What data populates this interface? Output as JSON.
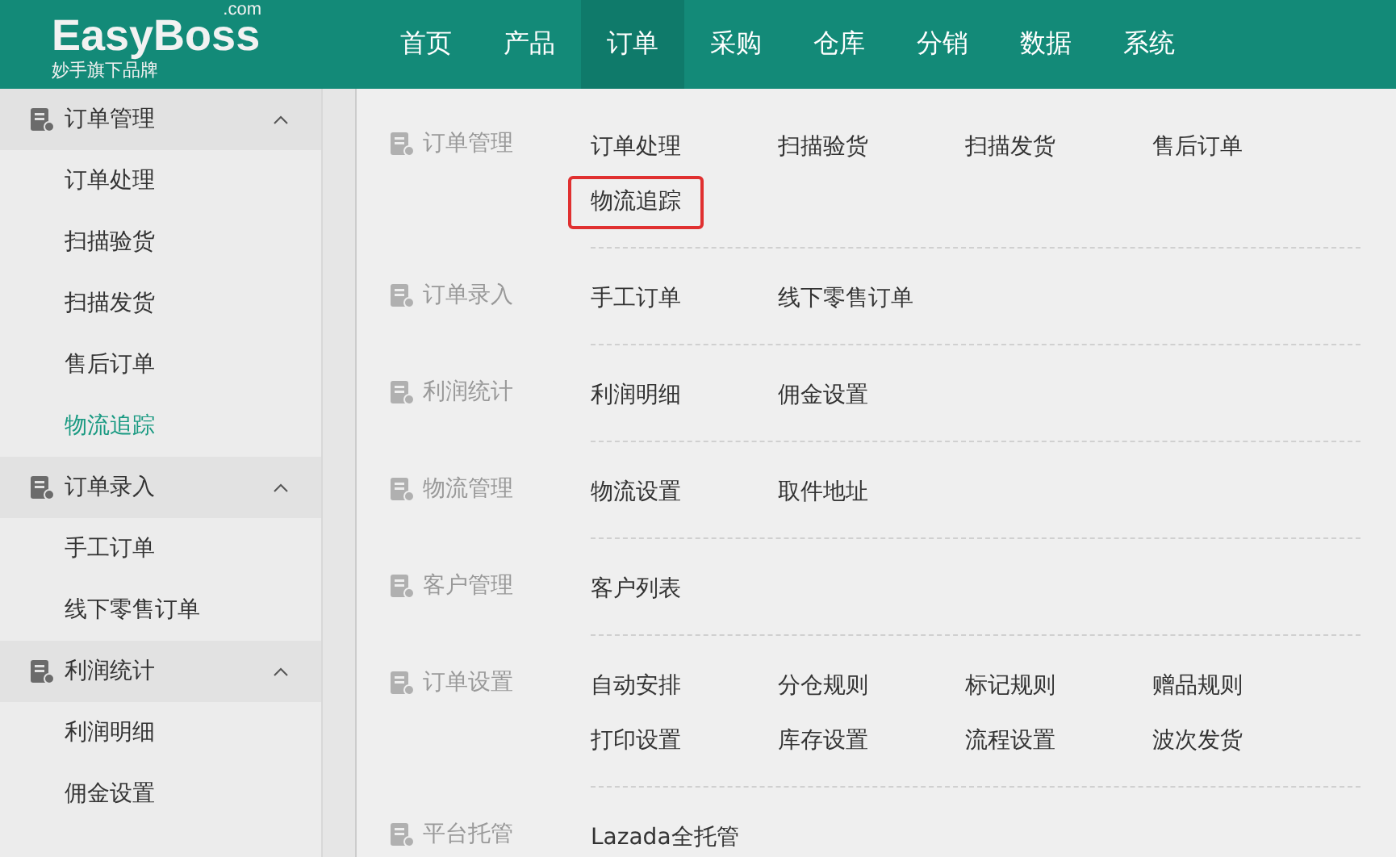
{
  "logo": {
    "name": "EasyBoss",
    "suffix": ".com",
    "tagline": "妙手旗下品牌"
  },
  "nav": [
    {
      "label": "首页",
      "selected": false
    },
    {
      "label": "产品",
      "selected": false
    },
    {
      "label": "订单",
      "selected": true
    },
    {
      "label": "采购",
      "selected": false
    },
    {
      "label": "仓库",
      "selected": false
    },
    {
      "label": "分销",
      "selected": false
    },
    {
      "label": "数据",
      "selected": false
    },
    {
      "label": "系统",
      "selected": false
    }
  ],
  "sidebar": [
    {
      "label": "订单管理",
      "expanded": true,
      "children": [
        {
          "label": "订单处理",
          "selected": false
        },
        {
          "label": "扫描验货",
          "selected": false
        },
        {
          "label": "扫描发货",
          "selected": false
        },
        {
          "label": "售后订单",
          "selected": false
        },
        {
          "label": "物流追踪",
          "selected": true
        }
      ]
    },
    {
      "label": "订单录入",
      "expanded": true,
      "children": [
        {
          "label": "手工订单",
          "selected": false
        },
        {
          "label": "线下零售订单",
          "selected": false
        }
      ]
    },
    {
      "label": "利润统计",
      "expanded": true,
      "children": [
        {
          "label": "利润明细",
          "selected": false
        },
        {
          "label": "佣金设置",
          "selected": false
        }
      ]
    }
  ],
  "menu": [
    {
      "label": "订单管理",
      "items": [
        {
          "label": "订单处理",
          "outlined": false
        },
        {
          "label": "扫描验货",
          "outlined": false
        },
        {
          "label": "扫描发货",
          "outlined": false
        },
        {
          "label": "售后订单",
          "outlined": false
        },
        {
          "label": "物流追踪",
          "outlined": true
        }
      ]
    },
    {
      "label": "订单录入",
      "items": [
        {
          "label": "手工订单",
          "outlined": false
        },
        {
          "label": "线下零售订单",
          "outlined": false
        }
      ]
    },
    {
      "label": "利润统计",
      "items": [
        {
          "label": "利润明细",
          "outlined": false
        },
        {
          "label": "佣金设置",
          "outlined": false
        }
      ]
    },
    {
      "label": "物流管理",
      "items": [
        {
          "label": "物流设置",
          "outlined": false
        },
        {
          "label": "取件地址",
          "outlined": false
        }
      ]
    },
    {
      "label": "客户管理",
      "items": [
        {
          "label": "客户列表",
          "outlined": false
        }
      ]
    },
    {
      "label": "订单设置",
      "items": [
        {
          "label": "自动安排",
          "outlined": false
        },
        {
          "label": "分仓规则",
          "outlined": false
        },
        {
          "label": "标记规则",
          "outlined": false
        },
        {
          "label": "赠品规则",
          "outlined": false
        },
        {
          "label": "打印设置",
          "outlined": false
        },
        {
          "label": "库存设置",
          "outlined": false
        },
        {
          "label": "流程设置",
          "outlined": false
        },
        {
          "label": "波次发货",
          "outlined": false
        }
      ]
    },
    {
      "label": "平台托管",
      "items": [
        {
          "label": "Lazada全托管",
          "outlined": false
        }
      ]
    }
  ]
}
